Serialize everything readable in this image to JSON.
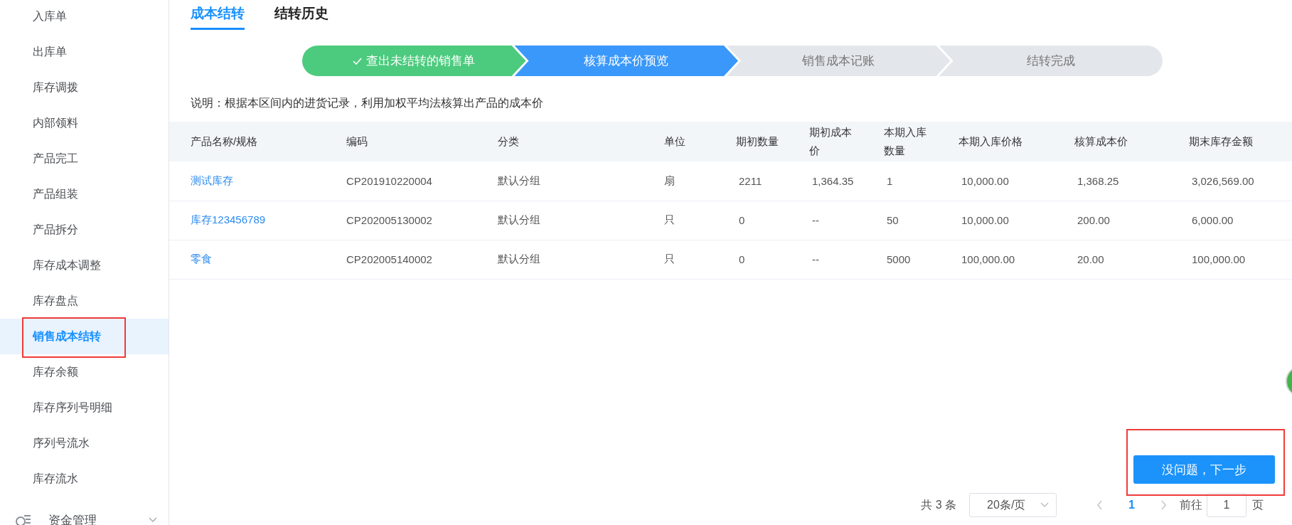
{
  "sidebar": {
    "items": [
      {
        "label": "入库单",
        "selected": false,
        "highlighted": false
      },
      {
        "label": "出库单",
        "selected": false,
        "highlighted": false
      },
      {
        "label": "库存调拨",
        "selected": false,
        "highlighted": false
      },
      {
        "label": "内部领料",
        "selected": false,
        "highlighted": false
      },
      {
        "label": "产品完工",
        "selected": false,
        "highlighted": false
      },
      {
        "label": "产品组装",
        "selected": false,
        "highlighted": false
      },
      {
        "label": "产品拆分",
        "selected": false,
        "highlighted": false
      },
      {
        "label": "库存成本调整",
        "selected": false,
        "highlighted": false
      },
      {
        "label": "库存盘点",
        "selected": false,
        "highlighted": false
      },
      {
        "label": "销售成本结转",
        "selected": true,
        "highlighted": true
      },
      {
        "label": "库存余额",
        "selected": false,
        "highlighted": false
      },
      {
        "label": "库存序列号明细",
        "selected": false,
        "highlighted": false
      },
      {
        "label": "序列号流水",
        "selected": false,
        "highlighted": false
      },
      {
        "label": "库存流水",
        "selected": false,
        "highlighted": false
      }
    ],
    "groups": [
      {
        "label": "资金管理",
        "expanded": false
      }
    ]
  },
  "tabs": [
    {
      "label": "成本结转",
      "selected": true
    },
    {
      "label": "结转历史",
      "selected": false
    }
  ],
  "steps": [
    {
      "label": "查出未结转的销售单",
      "done": true,
      "active": false
    },
    {
      "label": "核算成本价预览",
      "done": false,
      "active": true
    },
    {
      "label": "销售成本记账",
      "done": false,
      "active": false
    },
    {
      "label": "结转完成",
      "done": false,
      "active": false
    }
  ],
  "note": "说明：根据本区间内的进货记录，利用加权平均法核算出产品的成本价",
  "table": {
    "columns": [
      "产品名称/规格",
      "编码",
      "分类",
      "单位",
      "期初数量",
      "期初成本价",
      "本期入库数量",
      "本期入库价格",
      "核算成本价",
      "期末库存金额"
    ],
    "rows": [
      {
        "cells": [
          "测试库存",
          "CP201910220004",
          "默认分组",
          "扇",
          "2211",
          "1,364.35",
          "1",
          "10,000.00",
          "1,368.25",
          "3,026,569.00"
        ]
      },
      {
        "cells": [
          "库存123456789",
          "CP202005130002",
          "默认分组",
          "只",
          "0",
          "--",
          "50",
          "10,000.00",
          "200.00",
          "6,000.00"
        ]
      },
      {
        "cells": [
          "零食",
          "CP202005140002",
          "默认分组",
          "只",
          "0",
          "--",
          "5000",
          "100,000.00",
          "20.00",
          "100,000.00"
        ]
      }
    ]
  },
  "next_button": {
    "label": "没问题，下一步",
    "highlighted": true
  },
  "pagination": {
    "total": "共 3 条",
    "page_size": "20条/页",
    "pages": [
      {
        "label": "1",
        "selected": true
      }
    ],
    "goto_label": "前往",
    "goto_value": "1",
    "goto_suffix": "页"
  }
}
